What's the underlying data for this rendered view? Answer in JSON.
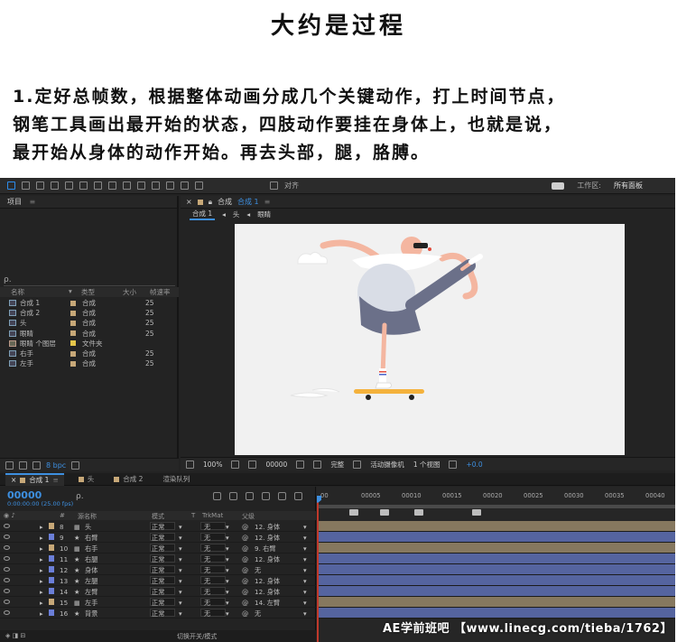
{
  "tutorial": {
    "title": "大约是过程",
    "lines": [
      "1.定好总帧数，根据整体动画分成几个关键动作，打上时间节点，",
      "钢笔工具画出最开始的状态，四肢动作要挂在身体上，也就是说，",
      "最开始从身体的动作开始。再去头部，腿，胳膊。"
    ]
  },
  "toolbar": {
    "align_label": "对齐",
    "workspace_label": "工作区:",
    "workspace_value": "所有面板"
  },
  "project": {
    "tab": "项目",
    "menu_glyph": "≡",
    "search_glyph": "ρ.",
    "columns": {
      "name": "名称",
      "type": "类型",
      "size": "大小",
      "fps": "帧速率"
    },
    "items": [
      {
        "name": "合成 1",
        "type": "合成",
        "fps": "25",
        "color": "#c7a878",
        "folder": false
      },
      {
        "name": "合成 2",
        "type": "合成",
        "fps": "25",
        "color": "#c7a878",
        "folder": false
      },
      {
        "name": "头",
        "type": "合成",
        "fps": "25",
        "color": "#c7a878",
        "folder": false
      },
      {
        "name": "眼睛",
        "type": "合成",
        "fps": "25",
        "color": "#c7a878",
        "folder": false
      },
      {
        "name": "眼睛 个图层",
        "type": "文件夹",
        "fps": "",
        "color": "#e6c64a",
        "folder": true
      },
      {
        "name": "右手",
        "type": "合成",
        "fps": "25",
        "color": "#c7a878",
        "folder": false
      },
      {
        "name": "左手",
        "type": "合成",
        "fps": "25",
        "color": "#c7a878",
        "folder": false
      }
    ],
    "bpc": "8 bpc"
  },
  "viewer": {
    "tab_prefix": "合成",
    "tab_name": "合成 1",
    "breadcrumbs": [
      "合成 1",
      "头",
      "眼睛"
    ],
    "zoom": "100%",
    "timecode": "00000",
    "quality": "完整",
    "camera": "活动摄像机",
    "views": "1 个视图",
    "exposure": "+0.0"
  },
  "timeline": {
    "tabs": [
      "合成 1",
      "头",
      "合成 2",
      "渲染队列"
    ],
    "timecode": "00000",
    "timecode_sub": "0:00:00:00 (25.00 fps)",
    "search_glyph": "ρ.",
    "columns": {
      "num": "#",
      "source": "源名称",
      "mode": "模式",
      "t": "T",
      "trkmat": "TrkMat",
      "parent": "父级"
    },
    "layers": [
      {
        "num": "8",
        "name": "头",
        "mode": "正常",
        "trk": "无",
        "parent": "12. 身体",
        "color": "#c7a878",
        "kind": "comp"
      },
      {
        "num": "9",
        "name": "右臂",
        "mode": "正常",
        "trk": "无",
        "parent": "12. 身体",
        "color": "#6b7fd8",
        "kind": "shape"
      },
      {
        "num": "10",
        "name": "右手",
        "mode": "正常",
        "trk": "无",
        "parent": "9. 右臂",
        "color": "#c7a878",
        "kind": "comp"
      },
      {
        "num": "11",
        "name": "右腿",
        "mode": "正常",
        "trk": "无",
        "parent": "12. 身体",
        "color": "#6b7fd8",
        "kind": "shape"
      },
      {
        "num": "12",
        "name": "身体",
        "mode": "正常",
        "trk": "无",
        "parent": "无",
        "color": "#6b7fd8",
        "kind": "shape"
      },
      {
        "num": "13",
        "name": "左腿",
        "mode": "正常",
        "trk": "无",
        "parent": "12. 身体",
        "color": "#6b7fd8",
        "kind": "shape"
      },
      {
        "num": "14",
        "name": "左臂",
        "mode": "正常",
        "trk": "无",
        "parent": "12. 身体",
        "color": "#6b7fd8",
        "kind": "shape"
      },
      {
        "num": "15",
        "name": "左手",
        "mode": "正常",
        "trk": "无",
        "parent": "14. 左臂",
        "color": "#c7a878",
        "kind": "comp"
      },
      {
        "num": "16",
        "name": "背景",
        "mode": "正常",
        "trk": "无",
        "parent": "无",
        "color": "#6b7fd8",
        "kind": "shape"
      }
    ],
    "ruler": [
      "00",
      "00005",
      "00010",
      "00015",
      "00020",
      "00025",
      "00030",
      "00035",
      "00040"
    ],
    "footer": "切换开关/模式"
  },
  "watermark": "AE学前班吧 【www.linecg.com/tieba/1762】"
}
